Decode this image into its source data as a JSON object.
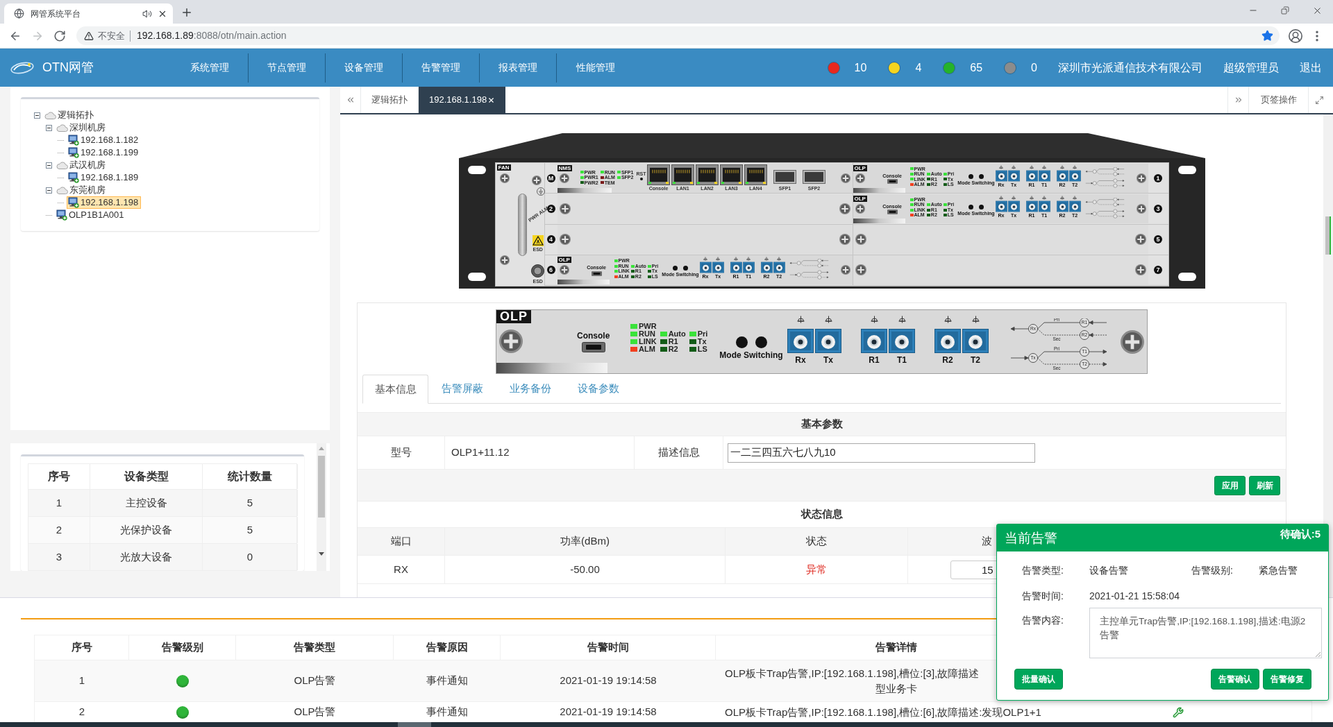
{
  "browser": {
    "tab": {
      "title": "网管系统平台",
      "selected": true,
      "audio": true
    },
    "nav_buttons": [
      {
        "kind": "back",
        "disabled": false
      },
      {
        "kind": "forward",
        "disabled": true
      },
      {
        "kind": "reload",
        "disabled": false
      }
    ],
    "address": {
      "security": "不安全",
      "host": "192.168.1.89",
      "path": ":8088/otn/main.action",
      "bookmarked": true
    }
  },
  "header": {
    "app_name": "OTN网管",
    "nav": [
      {
        "label": "系统管理"
      },
      {
        "label": "节点管理"
      },
      {
        "label": "设备管理"
      },
      {
        "label": "告警管理"
      },
      {
        "label": "报表管理"
      },
      {
        "label": "性能管理"
      }
    ],
    "alarm_counts": [
      {
        "color": "#e8281e",
        "count": "10"
      },
      {
        "color": "#f5d41f",
        "count": "4"
      },
      {
        "color": "#25b32a",
        "count": "65"
      },
      {
        "color": "#8c8c8c",
        "count": "0"
      }
    ],
    "company": "深圳市光派通信技术有限公司",
    "user": "超级管理员",
    "logout": "退出"
  },
  "tree": [
    {
      "label": "逻辑拓扑",
      "kind": "group",
      "expanded": true,
      "selected": false,
      "children": [
        {
          "label": "深圳机房",
          "kind": "group",
          "expanded": true,
          "selected": false,
          "children": [
            {
              "label": "192.168.1.182",
              "kind": "device",
              "selected": false
            },
            {
              "label": "192.168.1.199",
              "kind": "device",
              "selected": false
            }
          ]
        },
        {
          "label": "武汉机房",
          "kind": "group",
          "expanded": true,
          "selected": false,
          "children": [
            {
              "label": "192.168.1.189",
              "kind": "device",
              "selected": false
            }
          ]
        },
        {
          "label": "东莞机房",
          "kind": "group",
          "expanded": true,
          "selected": false,
          "children": [
            {
              "label": "192.168.1.198",
              "kind": "device",
              "selected": true
            }
          ]
        },
        {
          "label": "OLP1B1A001",
          "kind": "device",
          "selected": false
        }
      ]
    }
  ],
  "device_stats": {
    "columns": [
      "序号",
      "设备类型",
      "统计数量"
    ],
    "rows": [
      [
        "1",
        "主控设备",
        "5"
      ],
      [
        "2",
        "光保护设备",
        "5"
      ],
      [
        "3",
        "光放大设备",
        "0"
      ]
    ]
  },
  "page_tabs": {
    "items": [
      {
        "label": "逻辑拓扑",
        "selected": false,
        "closable": false
      },
      {
        "label": "192.168.1.198",
        "selected": true,
        "closable": true
      }
    ],
    "actions": "页签操作"
  },
  "chassis": {
    "fan": {
      "label": "FAN",
      "handle_labels": [
        "PWR",
        "ALM"
      ],
      "esd_labels": [
        "ESD",
        "ESD"
      ]
    },
    "slots": [
      {
        "number": "M",
        "kind": "nms",
        "card": {
          "title": "NMS",
          "led_columns": [
            {
              "leds": [
                {
                  "label": "PWR",
                  "color": "#3ae23a"
                },
                {
                  "label": "PWR1",
                  "color": "#3ae23a"
                },
                {
                  "label": "PWR2",
                  "color": "#135c18"
                }
              ]
            },
            {
              "leds": [
                {
                  "label": "RUN",
                  "color": "#3ae23a"
                },
                {
                  "label": "ALM",
                  "color": "#7a1a1a"
                },
                {
                  "label": "TEM",
                  "color": "#7a1a1a"
                }
              ]
            },
            {
              "leds": [
                {
                  "label": "SFP1",
                  "color": "#3ae23a"
                },
                {
                  "label": "SFP2",
                  "color": "#3ae23a"
                }
              ]
            }
          ],
          "reset": "RST",
          "ports": [
            {
              "label": "Console",
              "kind": "rj45"
            },
            {
              "label": "LAN1",
              "kind": "rj45"
            },
            {
              "label": "LAN2",
              "kind": "rj45"
            },
            {
              "label": "LAN3",
              "kind": "rj45"
            },
            {
              "label": "LAN4",
              "kind": "rj45"
            },
            {
              "label": "SFP1",
              "kind": "sfp"
            },
            {
              "label": "SFP2",
              "kind": "sfp"
            }
          ]
        }
      },
      {
        "number": "1",
        "kind": "olp",
        "card": {
          "title": "OLP",
          "console": "Console",
          "led_columns": [
            {
              "leds": [
                {
                  "label": "PWR",
                  "color": "#3ae23a"
                },
                {
                  "label": "RUN",
                  "color": "#3ae23a"
                },
                {
                  "label": "LINK",
                  "color": "#3ae23a"
                },
                {
                  "label": "ALM",
                  "color": "#f2401f"
                }
              ]
            },
            {
              "leds": [
                {
                  "label": "Auto",
                  "color": "#3ae23a"
                },
                {
                  "label": "R1",
                  "color": "#135c18"
                },
                {
                  "label": "R2",
                  "color": "#135c18"
                }
              ]
            },
            {
              "leds": [
                {
                  "label": "Pri",
                  "color": "#3ae23a"
                },
                {
                  "label": "Tx",
                  "color": "#135c18"
                },
                {
                  "label": "LS",
                  "color": "#135c18"
                }
              ]
            }
          ],
          "mode_switching": "Mode Switching",
          "port_groups": [
            [
              "Rx",
              "Tx"
            ],
            [
              "R1",
              "T1"
            ],
            [
              "R2",
              "T2"
            ]
          ],
          "diagram": [
            {
              "kind": "receive"
            },
            {
              "kind": "transmit"
            }
          ]
        }
      },
      {
        "number": "2",
        "kind": "empty"
      },
      {
        "number": "3",
        "kind": "olp",
        "card": {
          "title": "OLP",
          "console": "Console",
          "led_columns": [
            {
              "leds": [
                {
                  "label": "PWR",
                  "color": "#3ae23a"
                },
                {
                  "label": "RUN",
                  "color": "#3ae23a"
                },
                {
                  "label": "LINK",
                  "color": "#3ae23a"
                },
                {
                  "label": "ALM",
                  "color": "#f2401f"
                }
              ]
            },
            {
              "leds": [
                {
                  "label": "Auto",
                  "color": "#3ae23a"
                },
                {
                  "label": "R1",
                  "color": "#135c18"
                },
                {
                  "label": "R2",
                  "color": "#135c18"
                }
              ]
            },
            {
              "leds": [
                {
                  "label": "Pri",
                  "color": "#3ae23a"
                },
                {
                  "label": "Tx",
                  "color": "#135c18"
                },
                {
                  "label": "LS",
                  "color": "#135c18"
                }
              ]
            }
          ],
          "mode_switching": "Mode Switching",
          "port_groups": [
            [
              "Rx",
              "Tx"
            ],
            [
              "R1",
              "T1"
            ],
            [
              "R2",
              "T2"
            ]
          ],
          "diagram": [
            {
              "kind": "receive"
            },
            {
              "kind": "transmit"
            }
          ]
        }
      },
      {
        "number": "4",
        "kind": "empty"
      },
      {
        "number": "5",
        "kind": "empty"
      },
      {
        "number": "6",
        "kind": "olp",
        "card": {
          "title": "OLP",
          "console": "Console",
          "led_columns": [
            {
              "leds": [
                {
                  "label": "PWR",
                  "color": "#3ae23a"
                },
                {
                  "label": "RUN",
                  "color": "#3ae23a"
                },
                {
                  "label": "LINK",
                  "color": "#3ae23a"
                },
                {
                  "label": "ALM",
                  "color": "#f2401f"
                }
              ]
            },
            {
              "leds": [
                {
                  "label": "Auto",
                  "color": "#3ae23a"
                },
                {
                  "label": "R1",
                  "color": "#135c18"
                },
                {
                  "label": "R2",
                  "color": "#135c18"
                }
              ]
            },
            {
              "leds": [
                {
                  "label": "Pri",
                  "color": "#3ae23a"
                },
                {
                  "label": "Tx",
                  "color": "#135c18"
                },
                {
                  "label": "LS",
                  "color": "#135c18"
                }
              ]
            }
          ],
          "mode_switching": "Mode Switching",
          "port_groups": [
            [
              "Rx",
              "Tx"
            ],
            [
              "R1",
              "T1"
            ],
            [
              "R2",
              "T2"
            ]
          ],
          "diagram": [
            {
              "kind": "receive"
            },
            {
              "kind": "transmit"
            }
          ]
        }
      },
      {
        "number": "7",
        "kind": "empty"
      }
    ]
  },
  "card_detail": {
    "card": {
      "title": "OLP",
      "console": "Console",
      "led_columns": [
        {
          "leds": [
            {
              "label": "PWR",
              "color": "#3ae23a"
            },
            {
              "label": "RUN",
              "color": "#3ae23a"
            },
            {
              "label": "LINK",
              "color": "#3ae23a"
            },
            {
              "label": "ALM",
              "color": "#f2401f"
            }
          ]
        },
        {
          "leds": [
            {
              "label": "Auto",
              "color": "#3ae23a"
            },
            {
              "label": "R1",
              "color": "#135c18"
            },
            {
              "label": "R2",
              "color": "#135c18"
            }
          ]
        },
        {
          "leds": [
            {
              "label": "Pri",
              "color": "#3ae23a"
            },
            {
              "label": "Tx",
              "color": "#135c18"
            },
            {
              "label": "LS",
              "color": "#135c18"
            }
          ]
        }
      ],
      "mode_switching": "Mode Switching",
      "port_groups": [
        [
          "Rx",
          "Tx"
        ],
        [
          "R1",
          "T1"
        ],
        [
          "R2",
          "T2"
        ]
      ],
      "diagram": [
        {
          "kind": "receive",
          "common": "Rx",
          "labels": [
            "Pri",
            "Sec"
          ],
          "ends": [
            "R1",
            "R2"
          ]
        },
        {
          "kind": "transmit",
          "common": "Tx",
          "labels": [
            "Pri",
            "Sec"
          ],
          "ends": [
            "T1",
            "T2"
          ]
        }
      ]
    },
    "tabs": [
      {
        "label": "基本信息",
        "selected": true
      },
      {
        "label": "告警屏蔽",
        "selected": false
      },
      {
        "label": "业务备份",
        "selected": false
      },
      {
        "label": "设备参数",
        "selected": false
      }
    ],
    "basic": {
      "title": "基本参数",
      "model": {
        "label": "型号",
        "value": "OLP1+11.12"
      },
      "description": {
        "label": "描述信息",
        "value": "一二三四五六七八九10"
      },
      "buttons": [
        "应用",
        "刷新"
      ]
    },
    "status": {
      "title": "状态信息",
      "columns": [
        "端口",
        "功率(dBm)",
        "状态",
        "波"
      ],
      "rows": [
        {
          "port": "RX",
          "power": "-50.00",
          "state": "异常",
          "abnormal": true,
          "wavelength": "15"
        }
      ]
    }
  },
  "alarm_table": {
    "columns": [
      "序号",
      "告警级别",
      "告警类型",
      "告警原因",
      "告警时间",
      "告警详情"
    ],
    "rows": [
      {
        "index": "1",
        "color": "#2fb53a",
        "type": "OLP告警",
        "reason": "事件通知",
        "time": "2021-01-19 19:14:58",
        "detail": [
          "OLP板卡Trap告警,IP:[192.168.1.198],槽位:[3],故障描述",
          "型业务卡"
        ]
      },
      {
        "index": "2",
        "color": "#2fb53a",
        "type": "OLP告警",
        "reason": "事件通知",
        "time": "2021-01-19 19:14:58",
        "detail": [
          "OLP板卡Trap告警,IP:[192.168.1.198],槽位:[6],故障描述:发现OLP1+1"
        ],
        "repair": true
      }
    ]
  },
  "alarm_popup": {
    "title": "当前告警",
    "pending": "待确认:5",
    "fields": [
      {
        "label": "告警类型:",
        "value": "设备告警"
      },
      {
        "label": "告警级别:",
        "value": "紧急告警"
      }
    ],
    "time": {
      "label": "告警时间:",
      "value": "2021-01-21 15:58:04"
    },
    "content": {
      "label": "告警内容:",
      "value": "主控单元Trap告警,IP:[192.168.1.198],描述:电源2告警"
    },
    "batch_button": "批量确认",
    "actions": [
      "告警确认",
      "告警修复"
    ]
  }
}
